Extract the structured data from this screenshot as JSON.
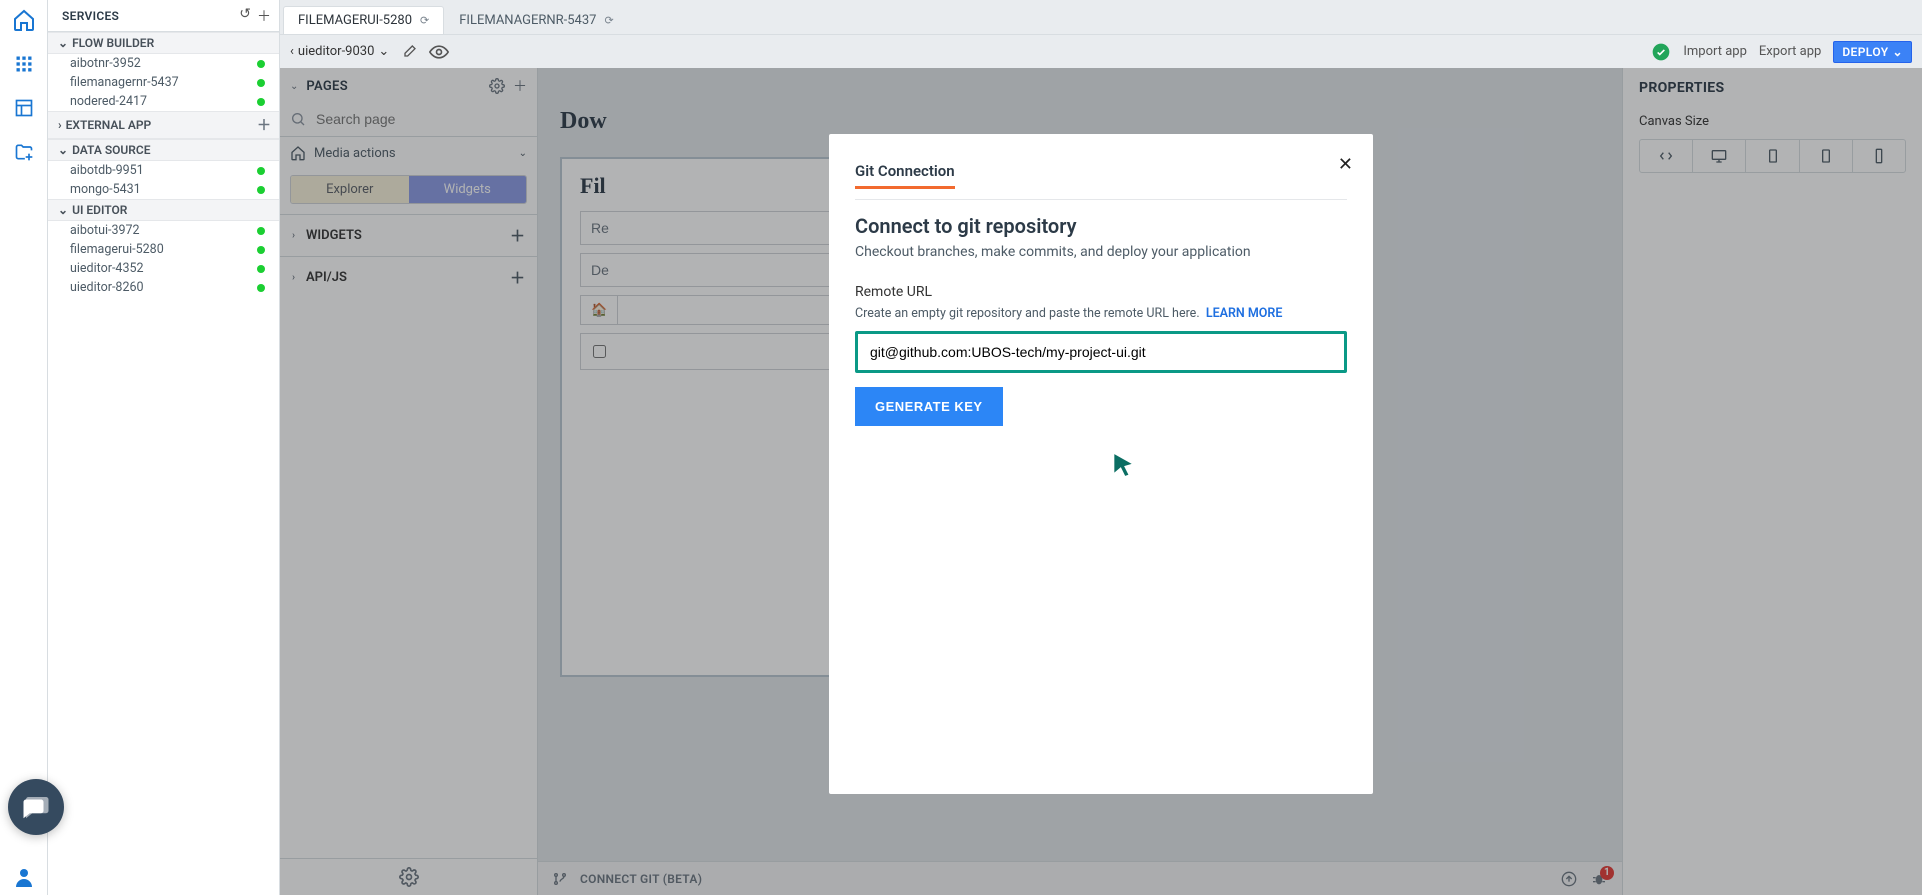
{
  "services": {
    "title": "SERVICES",
    "groups": {
      "flow_builder": {
        "label": "FLOW BUILDER",
        "items": [
          "aibotnr-3952",
          "filemanagernr-5437",
          "nodered-2417"
        ]
      },
      "external_app": {
        "label": "EXTERNAL APP"
      },
      "data_source": {
        "label": "DATA SOURCE",
        "items": [
          "aibotdb-9951",
          "mongo-5431"
        ]
      },
      "ui_editor": {
        "label": "UI EDITOR",
        "items": [
          "aibotui-3972",
          "filemagerui-5280",
          "uieditor-4352",
          "uieditor-8260"
        ]
      }
    }
  },
  "tabs": [
    {
      "label": "FILEMAGERUI-5280",
      "active": true
    },
    {
      "label": "FILEMANAGERNR-5437",
      "active": false
    }
  ],
  "toolbar": {
    "crumb": "uieditor-9030",
    "import": "Import app",
    "export": "Export app",
    "deploy": "DEPLOY"
  },
  "pages_panel": {
    "heading": "PAGES",
    "search_placeholder": "Search page",
    "media_actions": "Media actions",
    "widgets_label": "WIDGETS",
    "api_label": "API/JS",
    "seg": {
      "explorer": "Explorer",
      "widgets": "Widgets"
    }
  },
  "canvas": {
    "partial_heading": "Dow",
    "filebox_title": "Fil",
    "search_placeholder": "Re",
    "desc_placeholder": "De"
  },
  "bottom": {
    "connect_git": "CONNECT GIT (BETA)",
    "debug_badge": "1"
  },
  "props": {
    "title": "PROPERTIES",
    "canvas_size": "Canvas Size"
  },
  "modal": {
    "tab_title": "Git Connection",
    "heading": "Connect to git repository",
    "sub": "Checkout branches, make commits, and deploy your application",
    "url_label": "Remote URL",
    "url_hint": "Create an empty git repository and paste the remote URL here.",
    "learn_more": "LEARN MORE",
    "url_value": "git@github.com:UBOS-tech/my-project-ui.git",
    "generate_key": "GENERATE KEY"
  }
}
